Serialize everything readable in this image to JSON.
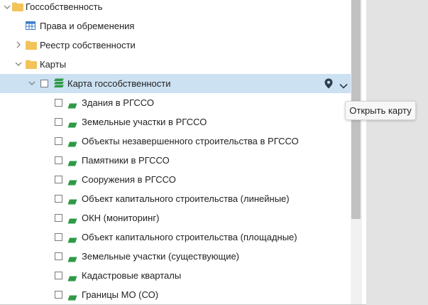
{
  "tree": {
    "root": {
      "label": "Госсобственность",
      "icon": "folder-icon",
      "expanded": true
    },
    "rights": {
      "label": "Права и обременения",
      "icon": "table-icon"
    },
    "registry": {
      "label": "Реестр собственности",
      "icon": "folder-icon",
      "expanded": false
    },
    "maps": {
      "label": "Карты",
      "icon": "folder-icon",
      "expanded": true
    },
    "map": {
      "label": "Карта госсобственности",
      "icon": "layers-icon",
      "checked": false,
      "selected": true
    },
    "layers": [
      {
        "label": "Здания в РГССО",
        "checked": false
      },
      {
        "label": "Земельные участки в РГССО",
        "checked": false
      },
      {
        "label": "Объекты незавершенного строительства в РГССО",
        "checked": false
      },
      {
        "label": "Памятники в РГССО",
        "checked": false
      },
      {
        "label": "Сооружения в РГССО",
        "checked": false
      },
      {
        "label": "Объект капитального строительства (линейные)",
        "checked": false
      },
      {
        "label": "ОКН (мониторинг)",
        "checked": false
      },
      {
        "label": "Объект капитального строительства (площадные)",
        "checked": false
      },
      {
        "label": "Земельные участки (существующие)",
        "checked": false
      },
      {
        "label": "Кадастровые кварталы",
        "checked": false
      },
      {
        "label": "Границы МО (СО)",
        "checked": false
      }
    ]
  },
  "tooltip": {
    "text": "Открыть карту"
  },
  "colors": {
    "folder": "#f2c35a",
    "layer": "#2e9a45",
    "selection": "#cce1f2",
    "table_icon": "#3a7bc8",
    "pin": "#2c3e50"
  }
}
